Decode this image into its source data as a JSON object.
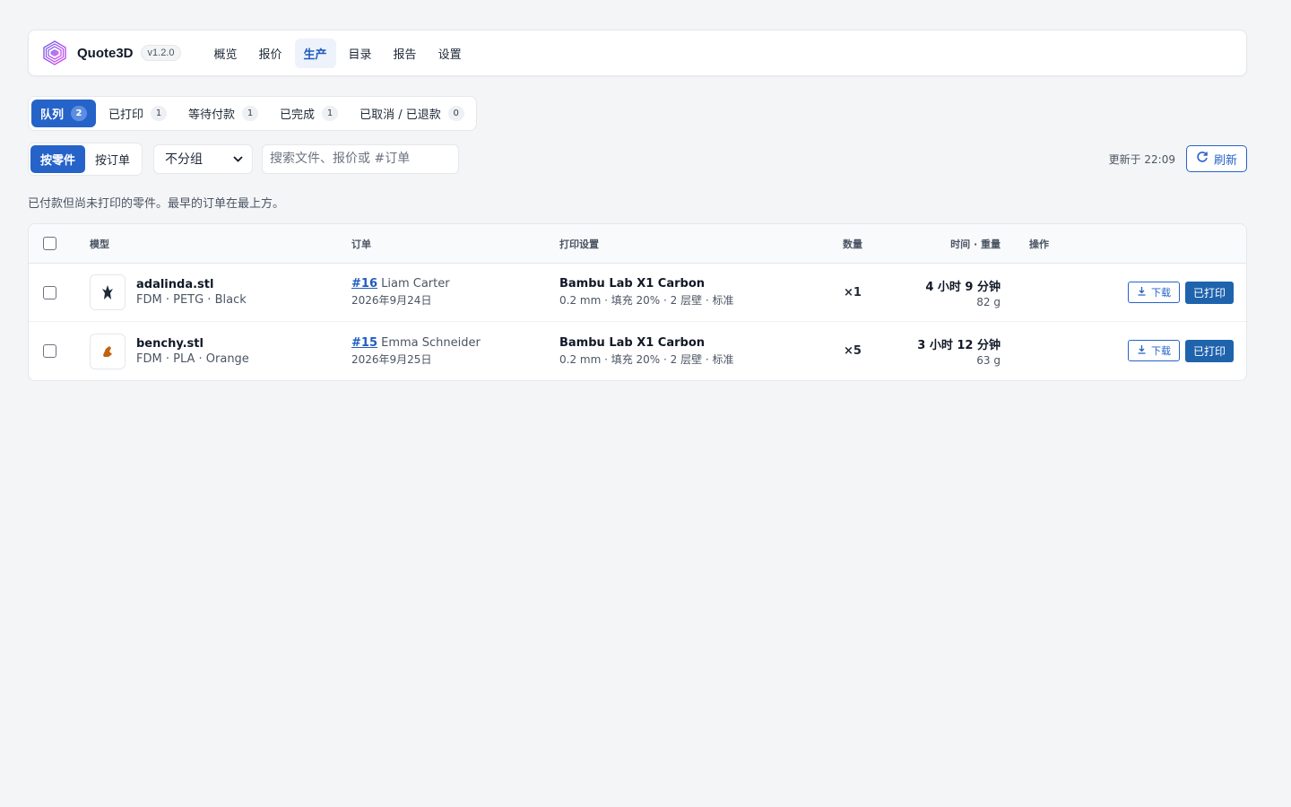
{
  "app": {
    "name": "Quote3D",
    "version": "v1.2.0"
  },
  "nav": [
    {
      "label": "概览",
      "active": false
    },
    {
      "label": "报价",
      "active": false
    },
    {
      "label": "生产",
      "active": true
    },
    {
      "label": "目录",
      "active": false
    },
    {
      "label": "报告",
      "active": false
    },
    {
      "label": "设置",
      "active": false
    }
  ],
  "status_tabs": [
    {
      "label": "队列",
      "count": "2",
      "active": true
    },
    {
      "label": "已打印",
      "count": "1",
      "active": false
    },
    {
      "label": "等待付款",
      "count": "1",
      "active": false
    },
    {
      "label": "已完成",
      "count": "1",
      "active": false
    },
    {
      "label": "已取消 / 已退款",
      "count": "0",
      "active": false
    }
  ],
  "toolbar": {
    "by_part": "按零件",
    "by_order": "按订单",
    "group_value": "不分组",
    "search_placeholder": "搜索文件、报价或 #订单",
    "updated": "更新于 22:09",
    "refresh": "刷新"
  },
  "hint": "已付款但尚未打印的零件。最早的订单在最上方。",
  "table": {
    "headers": {
      "model": "模型",
      "order": "订单",
      "settings": "打印设置",
      "qty": "数量",
      "time": "时间 · 重量",
      "ops": "操作"
    },
    "rows": [
      {
        "file": "adalinda.stl",
        "spec": "FDM · PETG · Black",
        "order_no": "#16",
        "customer": "Liam Carter",
        "date": "2026年9月24日",
        "printer": "Bambu Lab X1 Carbon",
        "settings": "0.2 mm · 填充 20% · 2 层壁 · 标准",
        "qty": "×1",
        "time": "4 小时 9 分钟",
        "weight": "82 g",
        "download": "下载",
        "printed": "已打印",
        "thumb_color": "#1f2937"
      },
      {
        "file": "benchy.stl",
        "spec": "FDM · PLA · Orange",
        "order_no": "#15",
        "customer": "Emma Schneider",
        "date": "2026年9月25日",
        "printer": "Bambu Lab X1 Carbon",
        "settings": "0.2 mm · 填充 20% · 2 层壁 · 标准",
        "qty": "×5",
        "time": "3 小时 12 分钟",
        "weight": "63 g",
        "download": "下载",
        "printed": "已打印",
        "thumb_color": "#c2620f"
      }
    ]
  }
}
